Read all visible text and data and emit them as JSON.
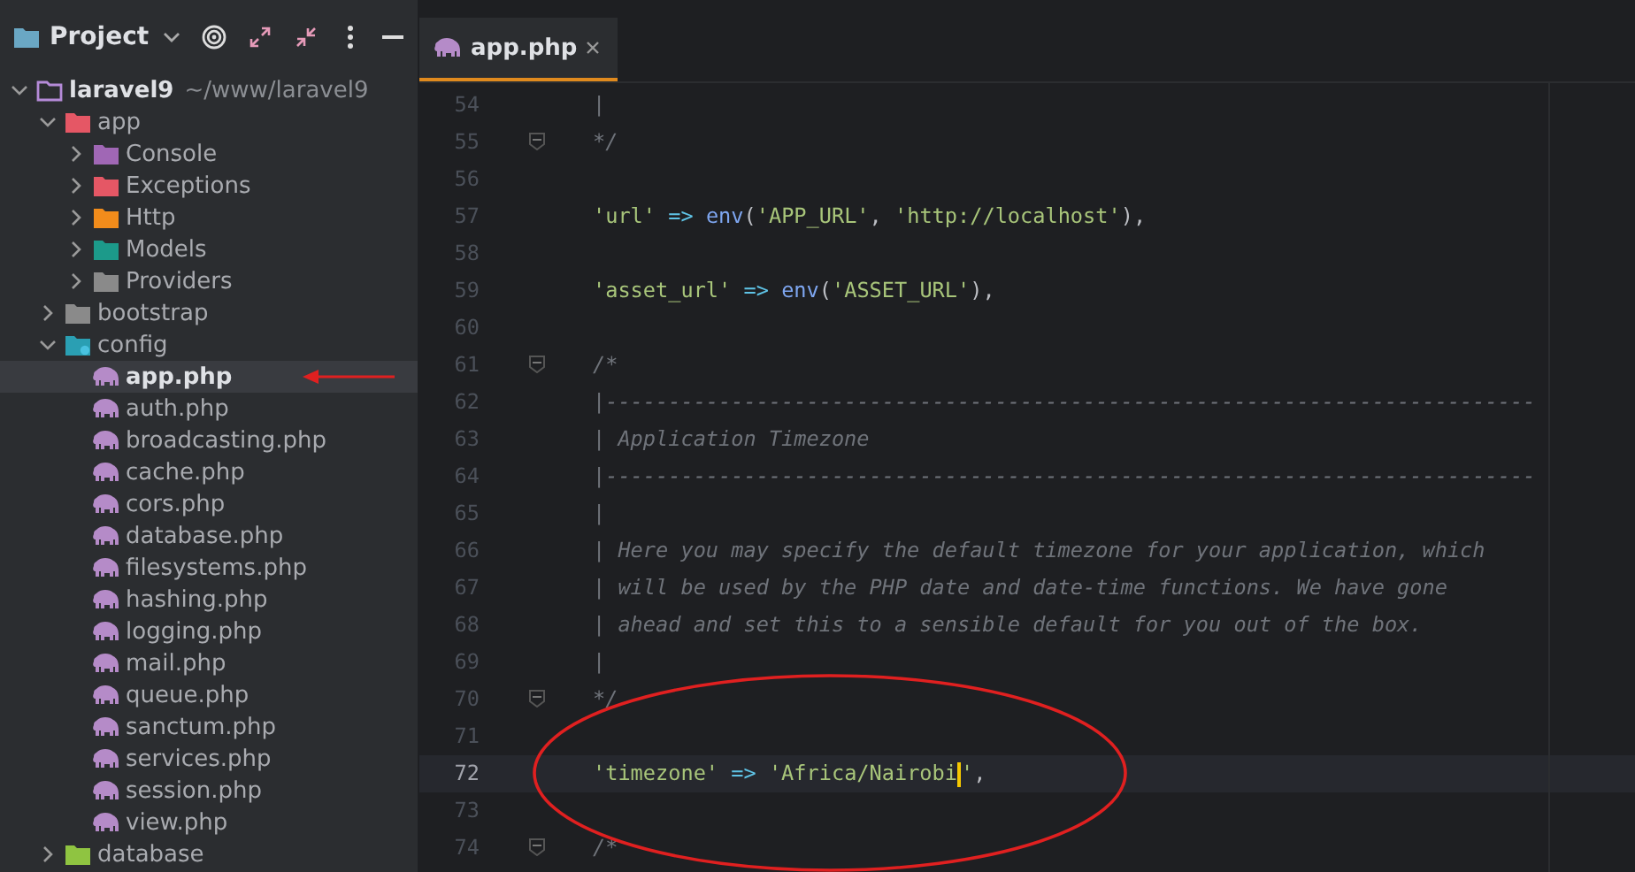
{
  "project_panel": {
    "title": "Project"
  },
  "tree": [
    {
      "label": "laravel9",
      "path": "~/www/laravel9",
      "kind": "project",
      "expanded": true,
      "selected": false,
      "children": [
        {
          "label": "app",
          "kind": "app",
          "expanded": true,
          "selected": false,
          "children": [
            {
              "label": "Console",
              "kind": "console",
              "expanded": false,
              "selected": false
            },
            {
              "label": "Exceptions",
              "kind": "exceptions",
              "expanded": false,
              "selected": false
            },
            {
              "label": "Http",
              "kind": "http",
              "expanded": false,
              "selected": false
            },
            {
              "label": "Models",
              "kind": "models",
              "expanded": false,
              "selected": false
            },
            {
              "label": "Providers",
              "kind": "providers",
              "expanded": false,
              "selected": false
            }
          ]
        },
        {
          "label": "bootstrap",
          "kind": "folder",
          "expanded": false,
          "selected": false
        },
        {
          "label": "config",
          "kind": "config",
          "expanded": true,
          "selected": false,
          "children": [
            {
              "label": "app.php",
              "kind": "php",
              "selected": true
            },
            {
              "label": "auth.php",
              "kind": "php",
              "selected": false
            },
            {
              "label": "broadcasting.php",
              "kind": "php",
              "selected": false
            },
            {
              "label": "cache.php",
              "kind": "php",
              "selected": false
            },
            {
              "label": "cors.php",
              "kind": "php",
              "selected": false
            },
            {
              "label": "database.php",
              "kind": "php",
              "selected": false
            },
            {
              "label": "filesystems.php",
              "kind": "php",
              "selected": false
            },
            {
              "label": "hashing.php",
              "kind": "php",
              "selected": false
            },
            {
              "label": "logging.php",
              "kind": "php",
              "selected": false
            },
            {
              "label": "mail.php",
              "kind": "php",
              "selected": false
            },
            {
              "label": "queue.php",
              "kind": "php",
              "selected": false
            },
            {
              "label": "sanctum.php",
              "kind": "php",
              "selected": false
            },
            {
              "label": "services.php",
              "kind": "php",
              "selected": false
            },
            {
              "label": "session.php",
              "kind": "php",
              "selected": false
            },
            {
              "label": "view.php",
              "kind": "php",
              "selected": false
            }
          ]
        },
        {
          "label": "database",
          "kind": "database",
          "expanded": false,
          "selected": false
        }
      ]
    }
  ],
  "tabs": [
    {
      "label": "app.php",
      "selected": true
    }
  ],
  "lines": [
    {
      "number": "54",
      "current": false,
      "fold": false,
      "tokens": [
        {
          "kind": "comment",
          "text": "|"
        }
      ]
    },
    {
      "number": "55",
      "current": false,
      "fold": true,
      "tokens": [
        {
          "kind": "comment",
          "text": "*/"
        }
      ]
    },
    {
      "number": "56",
      "current": false,
      "fold": false
    },
    {
      "number": "57",
      "current": false,
      "fold": false,
      "tokens": [
        {
          "kind": "string",
          "text": "'url'"
        },
        {
          "kind": "op",
          "text": " => "
        },
        {
          "kind": "func",
          "text": "env"
        },
        {
          "kind": "punct",
          "text": "("
        },
        {
          "kind": "string",
          "text": "'APP_URL'"
        },
        {
          "kind": "punct",
          "text": ", "
        },
        {
          "kind": "string",
          "text": "'http://localhost'"
        },
        {
          "kind": "punct",
          "text": "),"
        }
      ]
    },
    {
      "number": "58",
      "current": false,
      "fold": false
    },
    {
      "number": "59",
      "current": false,
      "fold": false,
      "tokens": [
        {
          "kind": "string",
          "text": "'asset_url'"
        },
        {
          "kind": "op",
          "text": " => "
        },
        {
          "kind": "func",
          "text": "env"
        },
        {
          "kind": "punct",
          "text": "("
        },
        {
          "kind": "string",
          "text": "'ASSET_URL'"
        },
        {
          "kind": "punct",
          "text": "),"
        }
      ]
    },
    {
      "number": "60",
      "current": false,
      "fold": false
    },
    {
      "number": "61",
      "current": false,
      "fold": true,
      "tokens": [
        {
          "kind": "comment",
          "text": "/*"
        }
      ]
    },
    {
      "number": "62",
      "current": false,
      "fold": false,
      "tokens": [
        {
          "kind": "comment",
          "text": "|--------------------------------------------------------------------------"
        }
      ]
    },
    {
      "number": "63",
      "current": false,
      "fold": false,
      "tokens": [
        {
          "kind": "comment",
          "text": "| Application Timezone"
        }
      ]
    },
    {
      "number": "64",
      "current": false,
      "fold": false,
      "tokens": [
        {
          "kind": "comment",
          "text": "|--------------------------------------------------------------------------"
        }
      ]
    },
    {
      "number": "65",
      "current": false,
      "fold": false,
      "tokens": [
        {
          "kind": "comment",
          "text": "|"
        }
      ]
    },
    {
      "number": "66",
      "current": false,
      "fold": false,
      "tokens": [
        {
          "kind": "comment",
          "text": "| Here you may specify the default timezone for your application, which"
        }
      ]
    },
    {
      "number": "67",
      "current": false,
      "fold": false,
      "tokens": [
        {
          "kind": "comment",
          "text": "| will be used by the PHP date and date-time functions. We have gone"
        }
      ]
    },
    {
      "number": "68",
      "current": false,
      "fold": false,
      "tokens": [
        {
          "kind": "comment",
          "text": "| ahead and set this to a sensible default for you out of the box."
        }
      ]
    },
    {
      "number": "69",
      "current": false,
      "fold": false,
      "tokens": [
        {
          "kind": "comment",
          "text": "|"
        }
      ]
    },
    {
      "number": "70",
      "current": false,
      "fold": true,
      "tokens": [
        {
          "kind": "comment",
          "text": "*/"
        }
      ]
    },
    {
      "number": "71",
      "current": false,
      "fold": false
    },
    {
      "number": "72",
      "current": true,
      "fold": false,
      "tokens": [
        {
          "kind": "string",
          "text": "'timezone'"
        },
        {
          "kind": "op",
          "text": " => "
        },
        {
          "kind": "string",
          "text": "'Africa/Nairobi"
        },
        {
          "kind": "caret"
        },
        {
          "kind": "string",
          "text": "'"
        },
        {
          "kind": "punct",
          "text": ","
        }
      ]
    },
    {
      "number": "73",
      "current": false,
      "fold": false
    },
    {
      "number": "74",
      "current": false,
      "fold": true,
      "tokens": [
        {
          "kind": "comment",
          "text": "/*"
        }
      ]
    }
  ]
}
